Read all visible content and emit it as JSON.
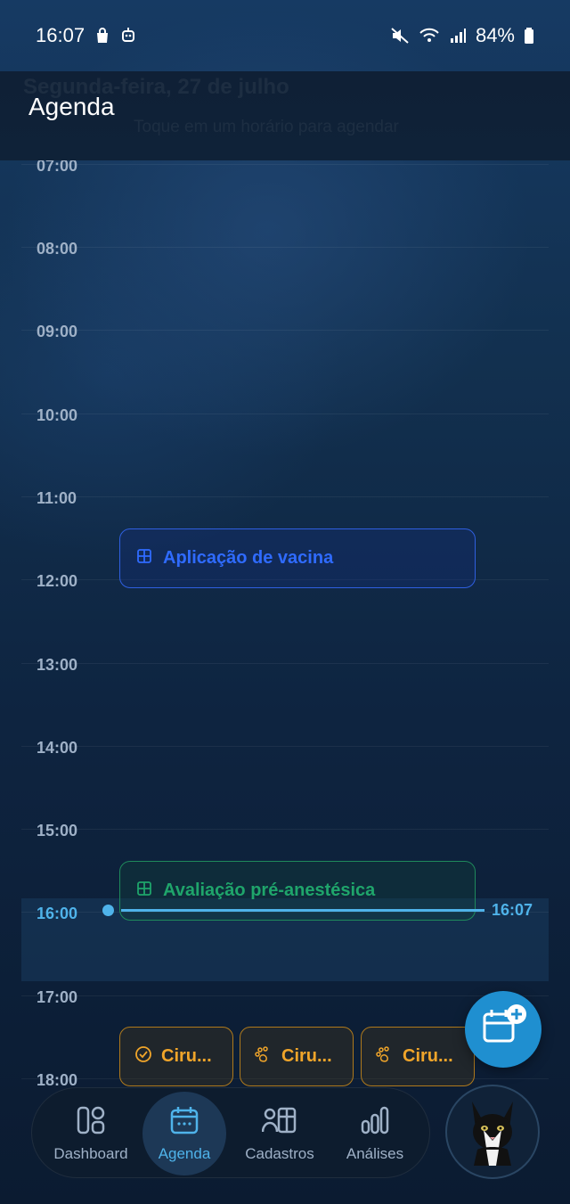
{
  "status_bar": {
    "time": "16:07",
    "battery": "84%"
  },
  "header": {
    "title": "Agenda",
    "ghost_date": "Segunda-feira, 27 de julho",
    "ghost_hint": "Toque em um horário para agendar"
  },
  "timeline": {
    "hours": [
      "07:00",
      "08:00",
      "09:00",
      "10:00",
      "11:00",
      "12:00",
      "13:00",
      "14:00",
      "15:00",
      "16:00",
      "17:00",
      "18:00"
    ],
    "current_hour": "16:00",
    "now_time": "16:07"
  },
  "events": {
    "vaccine": "Aplicação de vacina",
    "pre_anesthetic": "Avaliação pré-anestésica",
    "surgery_1": "Ciru...",
    "surgery_2": "Ciru...",
    "surgery_3": "Ciru..."
  },
  "nav": {
    "items": [
      {
        "label": "Dashboard",
        "icon": "dashboard-icon"
      },
      {
        "label": "Agenda",
        "icon": "calendar-icon",
        "active": true
      },
      {
        "label": "Cadastros",
        "icon": "registry-icon"
      },
      {
        "label": "Análises",
        "icon": "analytics-icon"
      }
    ]
  },
  "colors": {
    "accent": "#4fb3ea",
    "event_blue": "#2f6bff",
    "event_green": "#1fa56b",
    "event_orange": "#f0a52a",
    "fab": "#1f8fd0"
  }
}
